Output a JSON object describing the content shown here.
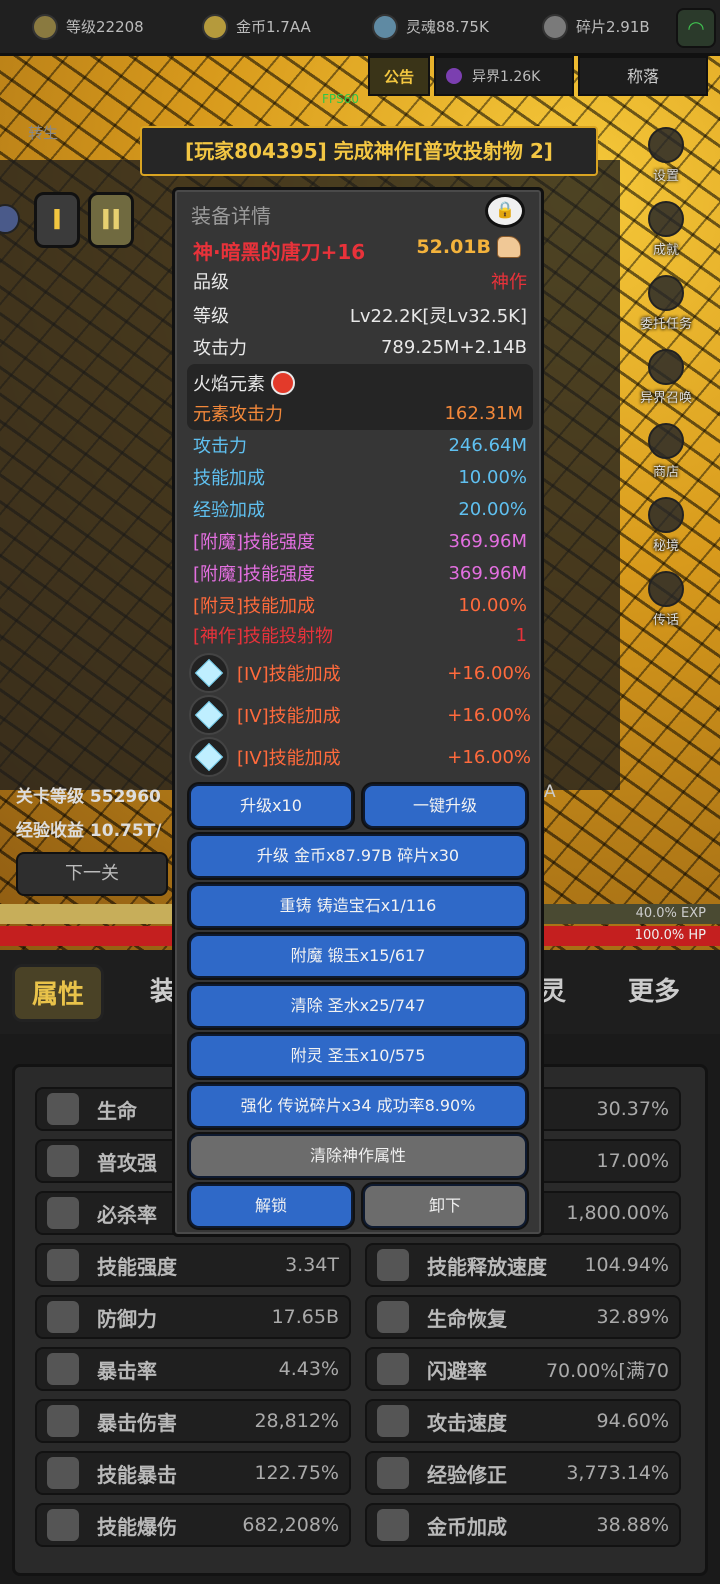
{
  "resources": [
    {
      "icon": "level-crown-icon",
      "label": "等级22208"
    },
    {
      "icon": "gold-coin-icon",
      "label": "金币1.7AA"
    },
    {
      "icon": "soul-icon",
      "label": "灵魂88.75K"
    },
    {
      "icon": "shard-icon",
      "label": "碎片2.91B"
    }
  ],
  "header": {
    "notice": "公告",
    "otherworld": "异界1.26K",
    "fall": "称落",
    "fps": "FPS60",
    "rebirth": "转生"
  },
  "announcement": "[玩家804395] 完成神作[普攻投射物 2]",
  "tiers": [
    "I",
    "II"
  ],
  "side_menu": [
    "设置",
    "成就",
    "委托任务",
    "异界召唤",
    "商店",
    "秘境",
    "传话"
  ],
  "stage": {
    "level": "关卡等级 552960",
    "exp_income": "经验收益 10.75T/",
    "next": "下一关",
    "side_a": "A"
  },
  "bars": {
    "exp_label": "40.0% EXP",
    "exp_fraction": 0.4,
    "hp_label": "100.0%  HP",
    "hp_fraction": 1.0
  },
  "tabs": [
    "属性",
    "装",
    "灵",
    "更多"
  ],
  "stats_left": [
    {
      "name": "生命",
      "value": ""
    },
    {
      "name": "普攻强",
      "value": ""
    },
    {
      "name": "必杀率",
      "value": ""
    },
    {
      "name": "技能强度",
      "value": "3.34T"
    },
    {
      "name": "防御力",
      "value": "17.65B"
    },
    {
      "name": "暴击率",
      "value": "4.43%"
    },
    {
      "name": "暴击伤害",
      "value": "28,812%"
    },
    {
      "name": "技能暴击",
      "value": "122.75%"
    },
    {
      "name": "技能爆伤",
      "value": "682,208%"
    }
  ],
  "stats_right": [
    {
      "name": "",
      "value": "30.37%"
    },
    {
      "name": "",
      "value": "17.00%"
    },
    {
      "name": "",
      "value": "1,800.00%"
    },
    {
      "name": "技能释放速度",
      "value": "104.94%"
    },
    {
      "name": "生命恢复",
      "value": "32.89%"
    },
    {
      "name": "闪避率",
      "value": "70.00%[满70"
    },
    {
      "name": "攻击速度",
      "value": "94.60%"
    },
    {
      "name": "经验修正",
      "value": "3,773.14%"
    },
    {
      "name": "金币加成",
      "value": "38.88%"
    }
  ],
  "modal": {
    "title": "装备详情",
    "item_name": "神·暗黑的唐刀+16",
    "power": "52.01B",
    "rows": [
      {
        "k": "品级",
        "v": "神作",
        "vcolor": "#e8323a"
      },
      {
        "k": "等级",
        "v": "Lv22.2K[灵Lv32.5K]",
        "vcolor": "#e8e8e8"
      },
      {
        "k": "攻击力",
        "v": "789.25M+2.14B",
        "vcolor": "#e8e8e8"
      }
    ],
    "element": {
      "name": "火焰元素",
      "k": "元素攻击力",
      "v": "162.31M",
      "color": "#f2883a"
    },
    "attrs": [
      {
        "k": "攻击力",
        "v": "246.64M",
        "color": "#5fc0f0"
      },
      {
        "k": "技能加成",
        "v": "10.00%",
        "color": "#5fc0f0"
      },
      {
        "k": "经验加成",
        "v": "20.00%",
        "color": "#5fc0f0"
      },
      {
        "k": "[附魔]技能强度",
        "v": "369.96M",
        "color": "#e36fe0"
      },
      {
        "k": "[附魔]技能强度",
        "v": "369.96M",
        "color": "#e36fe0"
      },
      {
        "k": "[附灵]技能加成",
        "v": "10.00%",
        "color": "#ff6a3c"
      },
      {
        "k": "[神作]技能投射物",
        "v": "1",
        "color": "#e8323a"
      }
    ],
    "gems": [
      {
        "k": "[IV]技能加成",
        "v": "+16.00%"
      },
      {
        "k": "[IV]技能加成",
        "v": "+16.00%"
      },
      {
        "k": "[IV]技能加成",
        "v": "+16.00%"
      }
    ],
    "buttons": {
      "upgrade10": "升级x10",
      "one_click": "一键升级",
      "upgrade": "升级 金币x87.97B 碎片x30",
      "reforge": "重铸 铸造宝石x1/116",
      "enchant": "附魔 锻玉x15/617",
      "clear": "清除 圣水x25/747",
      "spirit": "附灵 圣玉x10/575",
      "strengthen": "强化 传说碎片x34 成功率8.90%",
      "clear_divine": "清除神作属性",
      "unlock": "解锁",
      "unequip": "卸下"
    }
  }
}
